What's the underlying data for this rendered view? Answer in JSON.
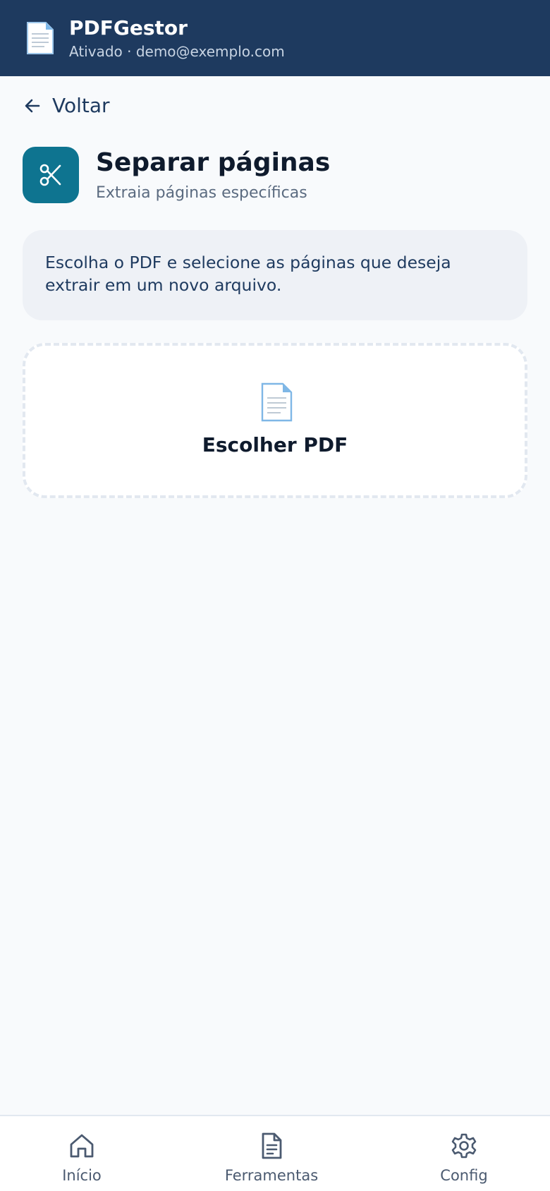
{
  "header": {
    "app_name": "PDFGestor",
    "status_line": "Ativado · demo@exemplo.com",
    "icon": "document-icon"
  },
  "back": {
    "label": "Voltar",
    "icon": "arrow-left-icon"
  },
  "tool": {
    "title": "Separar páginas",
    "subtitle": "Extraia páginas específicas",
    "icon": "scissors-icon",
    "accent_color": "#0e7490"
  },
  "info": {
    "text": "Escolha o PDF e selecione as páginas que deseja extrair em um novo arquivo."
  },
  "file_picker": {
    "label": "Escolher PDF",
    "icon": "document-icon"
  },
  "bottom_nav": {
    "items": [
      {
        "label": "Início",
        "icon": "home-icon"
      },
      {
        "label": "Ferramentas",
        "icon": "file-text-icon"
      },
      {
        "label": "Config",
        "icon": "gear-icon"
      }
    ]
  },
  "colors": {
    "header_bg": "#1e3a5f",
    "page_bg": "#f8fafc"
  }
}
